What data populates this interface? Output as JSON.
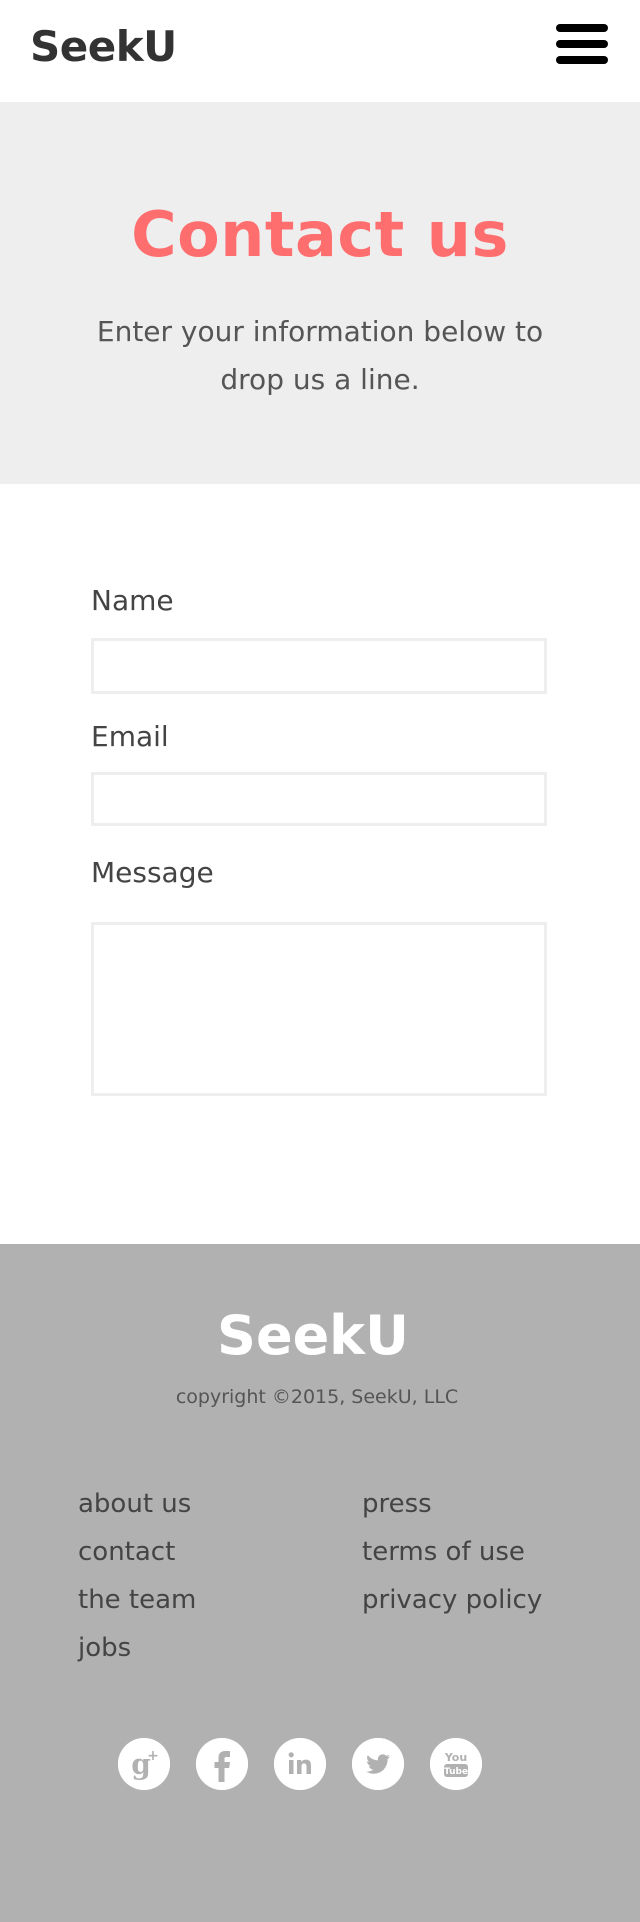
{
  "header": {
    "logo": "SeekU",
    "menu_icon": "hamburger-menu-icon"
  },
  "hero": {
    "title": "Contact us",
    "subtitle_line1": "Enter your information below to",
    "subtitle_line2": "drop us a line.",
    "background": "#eeeeee",
    "title_color": "#ff6e6e"
  },
  "form": {
    "name_label": "Name",
    "name_value": "",
    "email_label": "Email",
    "email_value": "",
    "message_label": "Message",
    "message_value": ""
  },
  "footer": {
    "logo": "SeekU",
    "copyright": "copyright ©2015, SeekU, LLC",
    "links_col1": [
      "about us",
      "contact",
      "the team",
      "jobs"
    ],
    "links_col2": [
      "press",
      "terms of use",
      "privacy policy"
    ],
    "social_icons": [
      "google-plus-icon",
      "facebook-icon",
      "linkedin-icon",
      "twitter-icon",
      "youtube-icon"
    ],
    "background": "#b1b1b1"
  }
}
